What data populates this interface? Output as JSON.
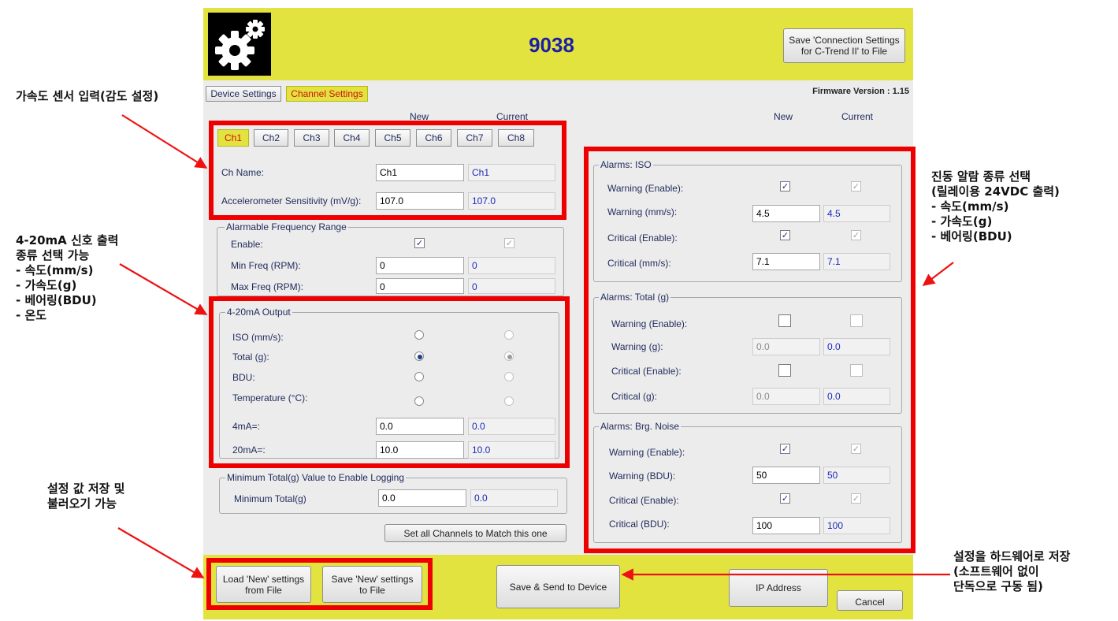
{
  "header": {
    "title": "9038",
    "save_conn_button": "Save 'Connection Settings for C-Trend II' to File"
  },
  "main_tabs": [
    "Device Settings",
    "Channel Settings"
  ],
  "firmware": "Firmware Version : 1.15",
  "col_headers": {
    "new": "New",
    "current": "Current"
  },
  "channel_tabs": [
    "Ch1",
    "Ch2",
    "Ch3",
    "Ch4",
    "Ch5",
    "Ch6",
    "Ch7",
    "Ch8"
  ],
  "channel": {
    "name_label": "Ch Name:",
    "name_new": "Ch1",
    "name_cur": "Ch1",
    "sens_label": "Accelerometer Sensitivity (mV/g):",
    "sens_new": "107.0",
    "sens_cur": "107.0"
  },
  "freq": {
    "title": "Alarmable Frequency Range",
    "enable_label": "Enable:",
    "enable_new": true,
    "enable_cur": true,
    "min_label": "Min Freq (RPM):",
    "min_new": "0",
    "min_cur": "0",
    "max_label": "Max Freq (RPM):",
    "max_new": "0",
    "max_cur": "0"
  },
  "output": {
    "title": "4-20mA Output",
    "options": [
      "ISO (mm/s):",
      "Total (g):",
      "BDU:",
      "Temperature (°C):"
    ],
    "selected": "Total (g):",
    "ma4_label": "4mA=:",
    "ma4_new": "0.0",
    "ma4_cur": "0.0",
    "ma20_label": "20mA=:",
    "ma20_new": "10.0",
    "ma20_cur": "10.0"
  },
  "logging": {
    "title": "Minimum Total(g) Value to Enable Logging",
    "label": "Minimum Total(g)",
    "new": "0.0",
    "cur": "0.0"
  },
  "set_all_button": "Set all Channels to Match this one",
  "alarms": {
    "iso": {
      "title": "Alarms: ISO",
      "warn_en_label": "Warning (Enable):",
      "warn_en_new": true,
      "warn_en_cur": true,
      "warn_label": "Warning (mm/s):",
      "warn_new": "4.5",
      "warn_cur": "4.5",
      "crit_en_label": "Critical (Enable):",
      "crit_en_new": true,
      "crit_en_cur": true,
      "crit_label": "Critical (mm/s):",
      "crit_new": "7.1",
      "crit_cur": "7.1"
    },
    "total": {
      "title": "Alarms: Total (g)",
      "warn_en_label": "Warning (Enable):",
      "warn_en_new": false,
      "warn_en_cur": false,
      "warn_label": "Warning (g):",
      "warn_new": "0.0",
      "warn_cur": "0.0",
      "crit_en_label": "Critical (Enable):",
      "crit_en_new": false,
      "crit_en_cur": false,
      "crit_label": "Critical (g):",
      "crit_new": "0.0",
      "crit_cur": "0.0"
    },
    "brg": {
      "title": "Alarms: Brg. Noise",
      "warn_en_label": "Warning (Enable):",
      "warn_en_new": true,
      "warn_en_cur": true,
      "warn_label": "Warning (BDU):",
      "warn_new": "50",
      "warn_cur": "50",
      "crit_en_label": "Critical (Enable):",
      "crit_en_new": true,
      "crit_en_cur": true,
      "crit_label": "Critical (BDU):",
      "crit_new": "100",
      "crit_cur": "100"
    }
  },
  "footer": {
    "load_button": "Load 'New' settings from File",
    "save_file_button": "Save 'New' settings to File",
    "send_button": "Save & Send to Device",
    "ip_button": "IP Address",
    "cancel_button": "Cancel"
  },
  "annotations": {
    "sensor": "가속도 센서 입력(감도 설정)",
    "output": [
      "4-20mA 신호 출력",
      "종류 선택 가능",
      "-  속도(mm/s)",
      "-  가속도(g)",
      "-  베어링(BDU)",
      "-  온도"
    ],
    "save_load": [
      "설정 값 저장 및",
      "불러오기 가능"
    ],
    "alarm": [
      "진동 알람 종류 선택",
      "(릴레이용 24VDC 출력)",
      "-  속도(mm/s)",
      "-  가속도(g)",
      "-  베어링(BDU)"
    ],
    "hardware": [
      "설정을 하드웨어로 저장",
      "(소프트웨어 없이",
      "단독으로 구동 됨)"
    ]
  },
  "colors": {
    "accent": "#e3e33f",
    "highlight": "#ee0000",
    "title": "#1b1fa8"
  }
}
